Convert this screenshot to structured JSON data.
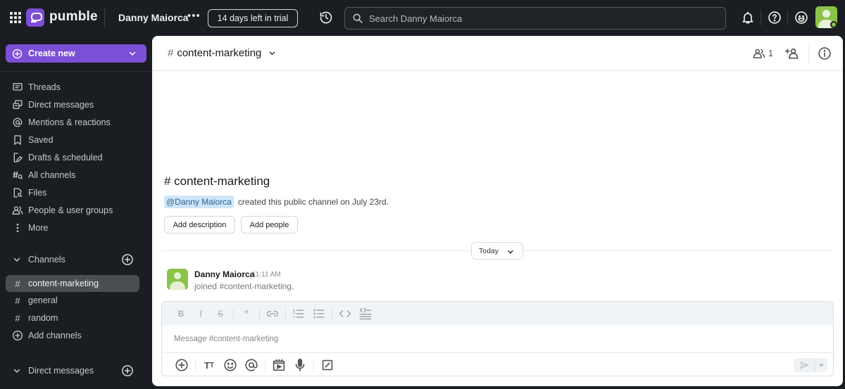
{
  "topbar": {
    "brand": "pumble",
    "workspace": "Danny Maiorca",
    "more_label": "•••",
    "trial_label": "14 days left in trial",
    "search_placeholder": "Search Danny Maiorca",
    "icons": [
      "apps-grid-icon",
      "pumble-logo",
      "history-icon",
      "search-icon",
      "bell-icon",
      "help-icon",
      "emoji-icon",
      "user-avatar"
    ]
  },
  "sidebar": {
    "create_new": "Create new",
    "nav": [
      {
        "label": "Threads",
        "icon": "threads-icon"
      },
      {
        "label": "Direct messages",
        "icon": "direct-messages-icon"
      },
      {
        "label": "Mentions & reactions",
        "icon": "at-icon"
      },
      {
        "label": "Saved",
        "icon": "bookmark-icon"
      },
      {
        "label": "Drafts & scheduled",
        "icon": "drafts-icon"
      },
      {
        "label": "All channels",
        "icon": "channel-search-icon"
      },
      {
        "label": "Files",
        "icon": "files-icon"
      },
      {
        "label": "People & user groups",
        "icon": "people-icon"
      },
      {
        "label": "More",
        "icon": "more-vertical-icon"
      }
    ],
    "channels_header": "Channels",
    "channels": [
      {
        "label": "content-marketing",
        "active": true
      },
      {
        "label": "general",
        "active": false
      },
      {
        "label": "random",
        "active": false
      }
    ],
    "add_channels": "Add channels",
    "dm_header": "Direct messages"
  },
  "channel": {
    "hash": "#",
    "name": "content-marketing",
    "member_count": "1",
    "intro_title": "# content-marketing",
    "intro_mention": "@Danny Maiorca",
    "intro_text": "created this public channel on July 23rd.",
    "add_description": "Add description",
    "add_people": "Add people",
    "day_divider": "Today"
  },
  "messages": [
    {
      "author": "Danny Maiorca",
      "time": "11:11 AM",
      "text": "joined #content-marketing."
    }
  ],
  "composer": {
    "placeholder": "Message #content-marketing",
    "format_buttons": [
      "bold",
      "italic",
      "strikethrough",
      "quote",
      "link",
      "ordered-list",
      "bullet-list",
      "code",
      "code-block"
    ],
    "action_buttons": [
      "attach",
      "text-format",
      "emoji",
      "mention",
      "video-clip",
      "voice",
      "slash-command"
    ]
  },
  "colors": {
    "accent": "#7b4fd6",
    "sidebar_bg": "#1a1d21",
    "active_item": "#4a4d52",
    "avatar": "#8bc34a",
    "mention_bg": "#cfe6f8"
  }
}
